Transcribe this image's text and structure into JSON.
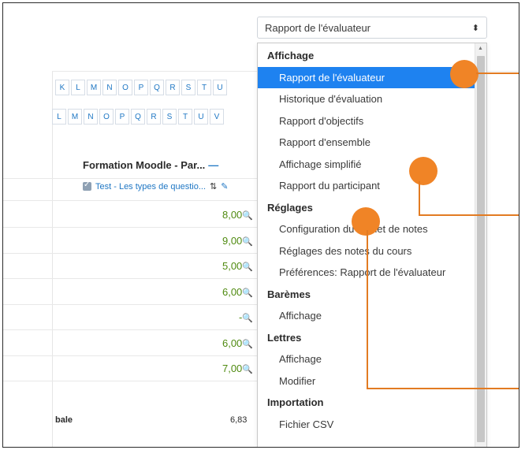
{
  "report_select": {
    "value": "Rapport de l'évaluateur",
    "arrow_icon": "sort-arrows-icon"
  },
  "letters_row1": [
    "K",
    "L",
    "M",
    "N",
    "O",
    "P",
    "Q",
    "R",
    "S",
    "T",
    "U"
  ],
  "letters_row2": [
    "L",
    "M",
    "N",
    "O",
    "P",
    "Q",
    "R",
    "S",
    "T",
    "U",
    "V"
  ],
  "grade_column": {
    "header": "Formation Moodle - Par...",
    "subheader": "Test - Les types de questio...",
    "grades": [
      "8,00",
      "9,00",
      "5,00",
      "6,00",
      "-",
      "6,00",
      "7,00"
    ],
    "total_label": "bale",
    "total_value": "6,83"
  },
  "menu": [
    {
      "type": "group",
      "label": "Affichage"
    },
    {
      "type": "option",
      "label": "Rapport de l'évaluateur",
      "selected": true
    },
    {
      "type": "option",
      "label": "Historique d'évaluation"
    },
    {
      "type": "option",
      "label": "Rapport d'objectifs"
    },
    {
      "type": "option",
      "label": "Rapport d'ensemble"
    },
    {
      "type": "option",
      "label": "Affichage simplifié"
    },
    {
      "type": "option",
      "label": "Rapport du participant"
    },
    {
      "type": "group",
      "label": "Réglages"
    },
    {
      "type": "option",
      "label": "Configuration du carnet de notes"
    },
    {
      "type": "option",
      "label": "Réglages des notes du cours"
    },
    {
      "type": "option",
      "label": "Préférences: Rapport de l'évaluateur"
    },
    {
      "type": "group",
      "label": "Barèmes"
    },
    {
      "type": "option",
      "label": "Affichage"
    },
    {
      "type": "group",
      "label": "Lettres"
    },
    {
      "type": "option",
      "label": "Affichage"
    },
    {
      "type": "option",
      "label": "Modifier"
    },
    {
      "type": "group",
      "label": "Importation"
    },
    {
      "type": "option",
      "label": "Fichier CSV"
    }
  ],
  "colors": {
    "accent": "#1e82f0",
    "marker": "#f08426",
    "grade_text": "#4f8a10",
    "link": "#1f77c4"
  }
}
